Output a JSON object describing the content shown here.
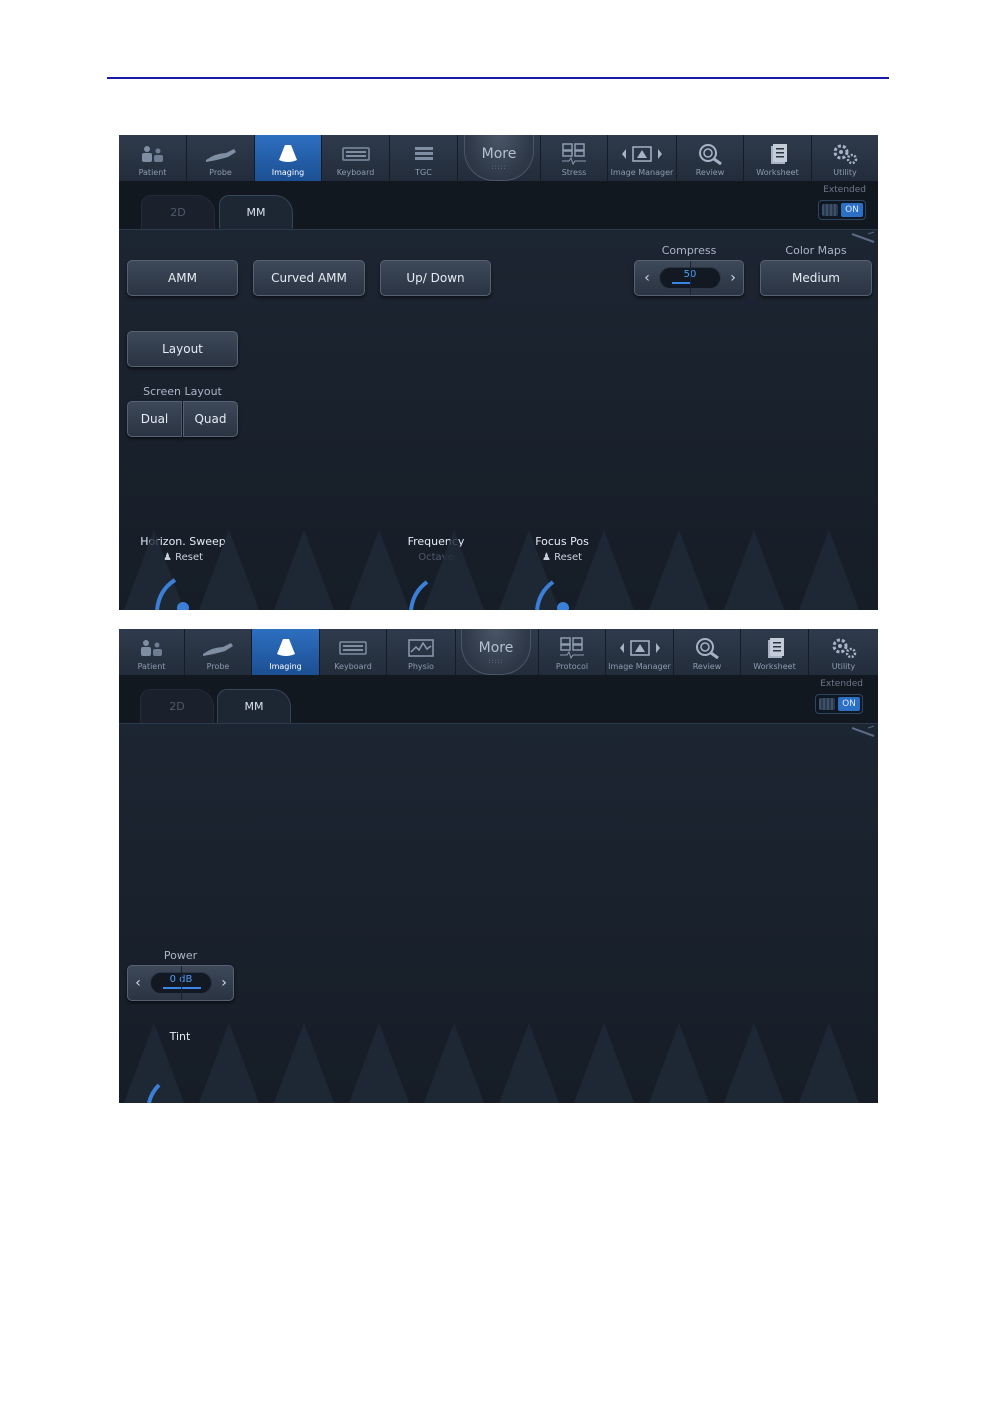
{
  "nav": {
    "patient": "Patient",
    "probe": "Probe",
    "imaging": "Imaging",
    "keyboard": "Keyboard",
    "tgc": "TGC",
    "physio": "Physio",
    "more": "More",
    "stress": "Stress",
    "protocol": "Protocol",
    "image_manager": "Image Manager",
    "review": "Review",
    "worksheet": "Worksheet",
    "utility": "Utility"
  },
  "tabs": {
    "tab_2d": "2D",
    "tab_mm": "MM"
  },
  "extended": {
    "label": "Extended",
    "state": "ON"
  },
  "screen1": {
    "buttons": {
      "amm": "AMM",
      "curved_amm": "Curved AMM",
      "up_down": "Up/ Down",
      "layout": "Layout"
    },
    "compress": {
      "label": "Compress",
      "value": "50",
      "level": 0.5
    },
    "color_maps": {
      "label": "Color Maps",
      "value": "Medium"
    },
    "screen_layout": {
      "label": "Screen Layout",
      "dual": "Dual",
      "quad": "Quad"
    },
    "knobs": {
      "horizon_sweep": {
        "title": "Horizon. Sweep",
        "sub": "Reset"
      },
      "frequency": {
        "title": "Frequency",
        "sub": "Octave"
      },
      "focus_pos": {
        "title": "Focus Pos",
        "sub": "Reset"
      }
    }
  },
  "screen2": {
    "power": {
      "label": "Power",
      "value": "0 dB",
      "level": 1.0
    },
    "tint": {
      "title": "Tint"
    }
  },
  "colors": {
    "accent": "#2b70c4",
    "highlight": "#4e9cf5",
    "background": "#1b2330"
  }
}
